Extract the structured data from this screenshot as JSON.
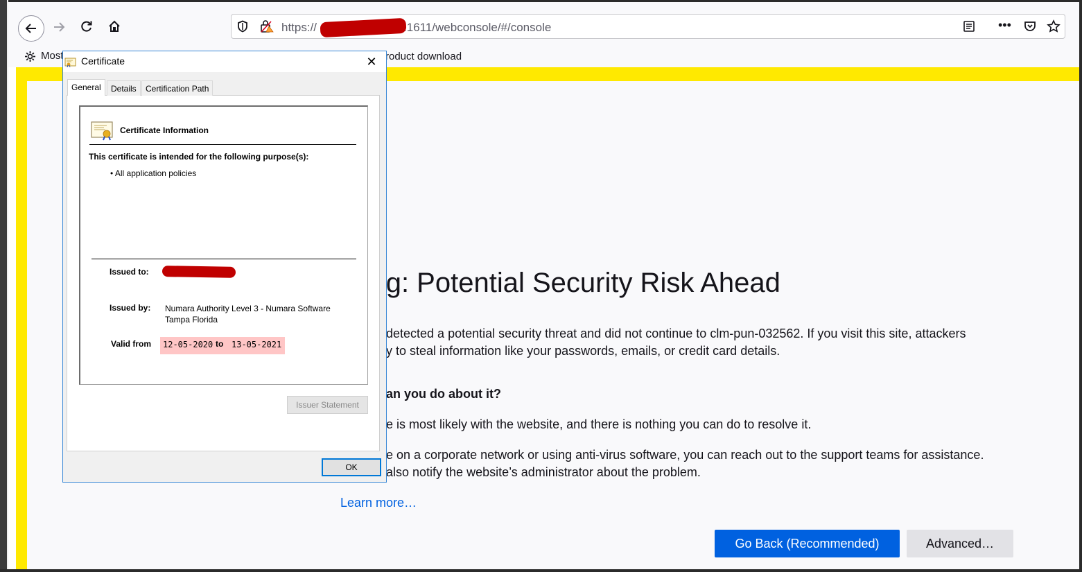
{
  "browser": {
    "url_prefix": "https://",
    "url_suffix": ":1611/webconsole/#/console",
    "bookmarks": {
      "most_visited": "Most",
      "product_download": "roduct download"
    }
  },
  "page": {
    "title": "rning: Potential Security Risk Ahead",
    "p1_line1": "detected a potential security threat and did not continue to clm-pun-032562. If you visit this site, attackers",
    "p1_line2": "y to steal information like your passwords, emails, or credit card details.",
    "heading2": "an you do about it?",
    "p2": "e is most likely with the website, and there is nothing you can do to resolve it.",
    "p3_line1": "e on a corporate network or using anti-virus software, you can reach out to the support teams for assistance.",
    "p3_line2": "also notify the website’s administrator about the problem.",
    "learn_more": "Learn more…",
    "go_back": "Go Back (Recommended)",
    "advanced": "Advanced…",
    "colors": {
      "accent": "#0061e0",
      "warning_border": "#ffe900"
    }
  },
  "dialog": {
    "title": "Certificate",
    "close": "✕",
    "tabs": [
      "General",
      "Details",
      "Certification Path"
    ],
    "info_title": "Certificate Information",
    "purpose_heading": "This certificate is intended for the following purpose(s):",
    "purpose_item": "• All application policies",
    "issued_to_label": "Issued to:",
    "issued_by_label": "Issued by:",
    "issued_by_line1": "Numara Authority Level 3 - Numara Software",
    "issued_by_line2": "Tampa Florida",
    "valid_from_label": "Valid from",
    "valid_from": "12-05-2020",
    "valid_to_label": "to",
    "valid_to": "13-05-2021",
    "issuer_statement": "Issuer Statement",
    "ok": "OK"
  }
}
